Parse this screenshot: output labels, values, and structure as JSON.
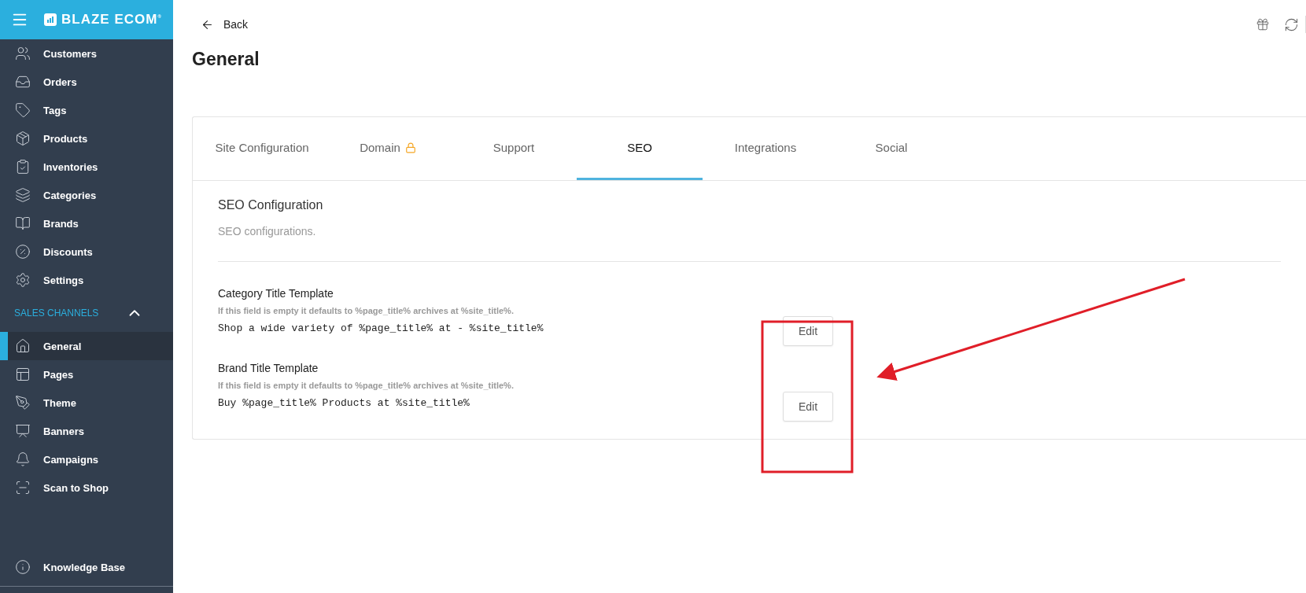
{
  "brand": {
    "name": "BLAZE ECOM",
    "mark": "®"
  },
  "sidebar": {
    "items": [
      {
        "label": "Customers",
        "selected": false
      },
      {
        "label": "Orders",
        "selected": false
      },
      {
        "label": "Tags",
        "selected": false
      },
      {
        "label": "Products",
        "selected": false
      },
      {
        "label": "Inventories",
        "selected": false
      },
      {
        "label": "Categories",
        "selected": false
      },
      {
        "label": "Brands",
        "selected": false
      },
      {
        "label": "Discounts",
        "selected": false
      },
      {
        "label": "Settings",
        "selected": false
      }
    ],
    "section": {
      "title": "SALES CHANNELS",
      "expanded": true,
      "items": [
        {
          "label": "General",
          "selected": true
        },
        {
          "label": "Pages",
          "selected": false
        },
        {
          "label": "Theme",
          "selected": false
        },
        {
          "label": "Banners",
          "selected": false
        },
        {
          "label": "Campaigns",
          "selected": false
        },
        {
          "label": "Scan to Shop",
          "selected": false
        }
      ]
    },
    "footer_item": {
      "label": "Knowledge Base",
      "selected": false
    }
  },
  "back_link": "Back",
  "page_title": "General",
  "tabs": [
    {
      "label": "Site Configuration",
      "selected": false,
      "locked": false
    },
    {
      "label": "Domain",
      "selected": false,
      "locked": true
    },
    {
      "label": "Support",
      "selected": false,
      "locked": false
    },
    {
      "label": "SEO",
      "selected": true,
      "locked": false
    },
    {
      "label": "Integrations",
      "selected": false,
      "locked": false
    },
    {
      "label": "Social",
      "selected": false,
      "locked": false
    }
  ],
  "section": {
    "title": "SEO Configuration",
    "subtitle": "SEO configurations."
  },
  "fields": [
    {
      "label": "Category Title Template",
      "hint": "If this field is empty it defaults to %page_title% archives at %site_title%.",
      "value": "Shop a wide variety of %page_title% at - %site_title%",
      "button": "Edit"
    },
    {
      "label": "Brand Title Template",
      "hint": "If this field is empty it defaults to %page_title% archives at %site_title%.",
      "value": "Buy %page_title% Products at %site_title%",
      "button": "Edit"
    }
  ]
}
